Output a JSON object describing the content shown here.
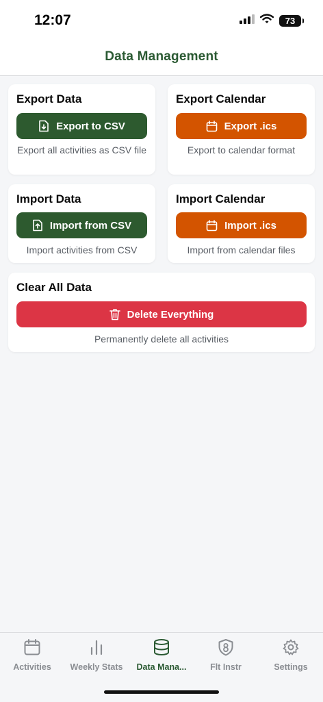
{
  "status": {
    "time": "12:07",
    "battery": "73"
  },
  "header": {
    "title": "Data Management"
  },
  "cards": {
    "export_data": {
      "title": "Export Data",
      "button": "Export to CSV",
      "description": "Export all activities as CSV file"
    },
    "export_calendar": {
      "title": "Export Calendar",
      "button": "Export .ics",
      "description": "Export to calendar format"
    },
    "import_data": {
      "title": "Import Data",
      "button": "Import from CSV",
      "description": "Import activities from CSV"
    },
    "import_calendar": {
      "title": "Import Calendar",
      "button": "Import .ics",
      "description": "Import from calendar files"
    },
    "clear_data": {
      "title": "Clear All Data",
      "button": "Delete Everything",
      "description": "Permanently delete all activities"
    }
  },
  "tabs": [
    {
      "label": "Activities",
      "icon": "calendar-icon"
    },
    {
      "label": "Weekly Stats",
      "icon": "bar-chart-icon"
    },
    {
      "label": "Data Mana...",
      "icon": "database-icon"
    },
    {
      "label": "Flt Instr",
      "icon": "shield-icon"
    },
    {
      "label": "Settings",
      "icon": "gear-icon"
    }
  ],
  "colors": {
    "green": "#2d5a2f",
    "orange": "#d35400",
    "red": "#dc3545",
    "title_green": "#2b5a33",
    "background": "#f5f6f8"
  }
}
